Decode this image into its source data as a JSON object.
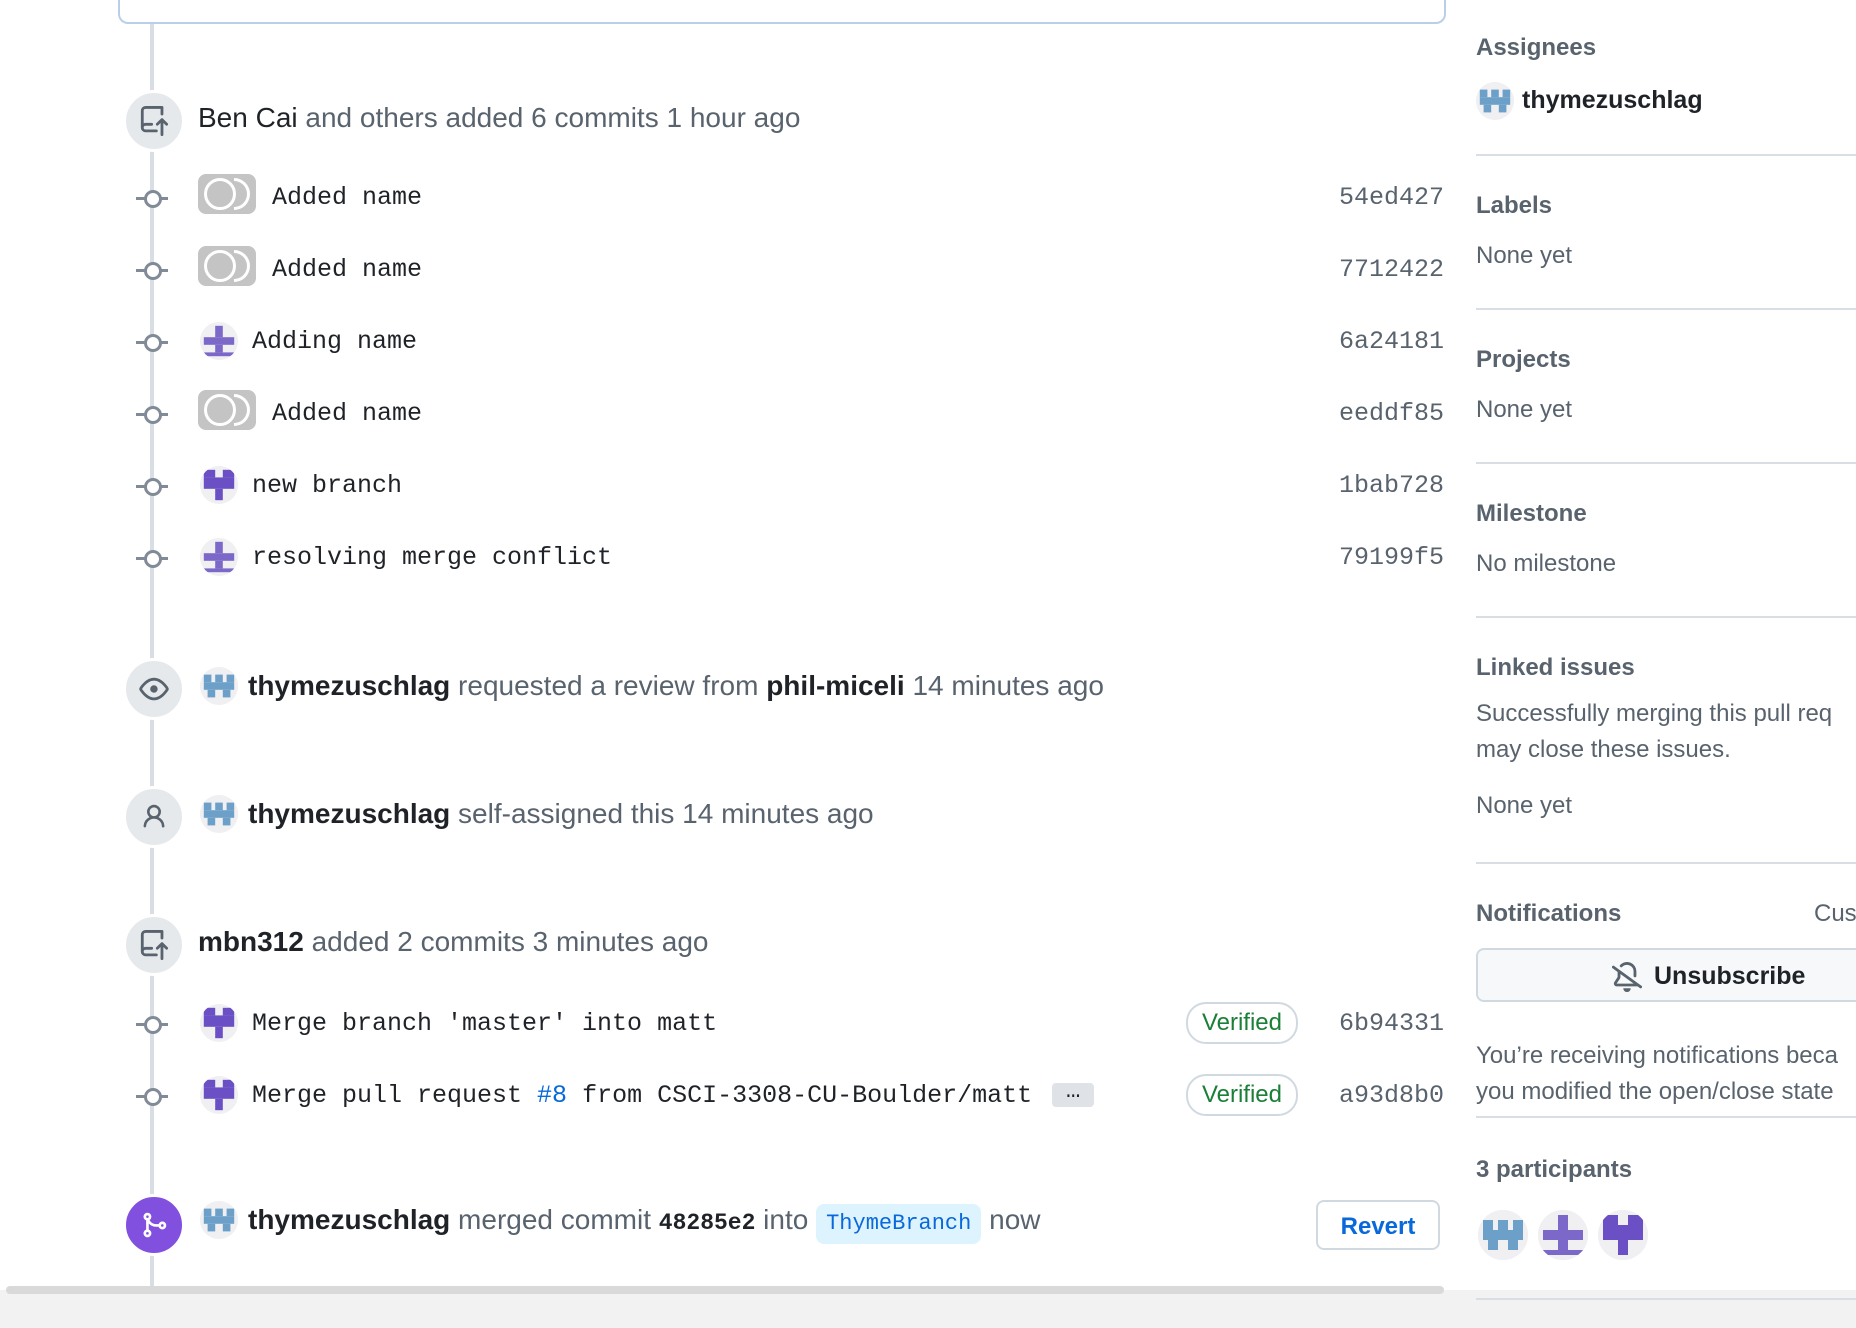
{
  "timeline": {
    "event_commits_1": {
      "actor": "Ben Cai",
      "text": " and others added ",
      "count": "6 commits",
      "time": " 1 hour ago"
    },
    "commits_1": [
      {
        "message": "Added name",
        "sha": "54ed427",
        "avatar": "github-default"
      },
      {
        "message": "Added name",
        "sha": "7712422",
        "avatar": "github-default"
      },
      {
        "message": "Adding name",
        "sha": "6a24181",
        "avatar": "identicon-purple"
      },
      {
        "message": "Added name",
        "sha": "eeddf85",
        "avatar": "github-default"
      },
      {
        "message": "new branch",
        "sha": "1bab728",
        "avatar": "identicon-purple"
      },
      {
        "message": "resolving merge conflict",
        "sha": "79199f5",
        "avatar": "identicon-purple"
      }
    ],
    "event_review": {
      "actor": "thymezuschlag",
      "text": " requested a review from ",
      "reviewer": "phil-miceli",
      "time": " 14 minutes ago"
    },
    "event_assign": {
      "actor": "thymezuschlag",
      "text": " self-assigned this ",
      "time": "14 minutes ago"
    },
    "event_commits_2": {
      "actor": "mbn312",
      "text": " added ",
      "count": "2 commits",
      "time": " 3 minutes ago"
    },
    "commits_2": [
      {
        "message": "Merge branch 'master' into matt",
        "verified": "Verified",
        "sha": "6b94331"
      },
      {
        "message_prefix": "Merge pull request ",
        "issue": "#8",
        "message_suffix": " from CSCI-3308-CU-Boulder/matt",
        "more": "…",
        "verified": "Verified",
        "sha": "a93d8b0"
      }
    ],
    "event_merged": {
      "actor": "thymezuschlag",
      "text": " merged commit ",
      "commit": "48285e2",
      "into": " into ",
      "branch": "ThymeBranch",
      "time": " now",
      "revert_label": "Revert"
    }
  },
  "sidebar": {
    "assignees": {
      "title": "Assignees",
      "user": "thymezuschlag"
    },
    "labels": {
      "title": "Labels",
      "value": "None yet"
    },
    "projects": {
      "title": "Projects",
      "value": "None yet"
    },
    "milestone": {
      "title": "Milestone",
      "value": "No milestone"
    },
    "linked_issues": {
      "title": "Linked issues",
      "description_line1": "Successfully merging this pull req",
      "description_line2": "may close these issues.",
      "value": "None yet"
    },
    "notifications": {
      "title": "Notifications",
      "customize": "Cus",
      "button": "Unsubscribe",
      "reason_line1": "You’re receiving notifications beca",
      "reason_line2": "you modified the open/close state"
    },
    "participants": {
      "title": "3 participants"
    }
  },
  "colors": {
    "accent": "#0969da",
    "merged": "#8250df",
    "verified": "#1a7f37",
    "muted": "#59636e"
  }
}
